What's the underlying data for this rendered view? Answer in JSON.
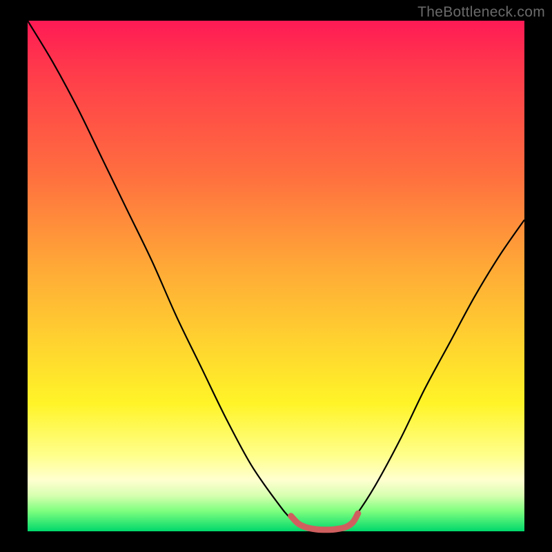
{
  "watermark": "TheBottleneck.com",
  "chart_data": {
    "type": "line",
    "title": "",
    "xlabel": "",
    "ylabel": "",
    "xlim": [
      0,
      1
    ],
    "ylim": [
      0,
      1
    ],
    "background_gradient": {
      "orientation": "vertical",
      "stops": [
        {
          "pos": 0.0,
          "color": "#ff1a55"
        },
        {
          "pos": 0.1,
          "color": "#ff3b4b"
        },
        {
          "pos": 0.3,
          "color": "#ff6e3f"
        },
        {
          "pos": 0.48,
          "color": "#ffa837"
        },
        {
          "pos": 0.62,
          "color": "#ffd030"
        },
        {
          "pos": 0.75,
          "color": "#fff428"
        },
        {
          "pos": 0.85,
          "color": "#ffff8a"
        },
        {
          "pos": 0.9,
          "color": "#ffffd0"
        },
        {
          "pos": 0.93,
          "color": "#d7ffb0"
        },
        {
          "pos": 0.96,
          "color": "#7fff7f"
        },
        {
          "pos": 1.0,
          "color": "#00d86b"
        }
      ]
    },
    "series": [
      {
        "name": "bottleneck-curve",
        "color": "#000000",
        "stroke_width": 2,
        "x": [
          0.0,
          0.05,
          0.1,
          0.15,
          0.2,
          0.25,
          0.3,
          0.35,
          0.4,
          0.45,
          0.5,
          0.53,
          0.56,
          0.6,
          0.64,
          0.66,
          0.7,
          0.75,
          0.8,
          0.85,
          0.9,
          0.95,
          1.0
        ],
        "y": [
          1.0,
          0.92,
          0.83,
          0.73,
          0.63,
          0.53,
          0.42,
          0.32,
          0.22,
          0.13,
          0.06,
          0.025,
          0.01,
          0.005,
          0.01,
          0.03,
          0.09,
          0.18,
          0.28,
          0.37,
          0.46,
          0.54,
          0.61
        ]
      },
      {
        "name": "flat-minimum-marker",
        "color": "#d06060",
        "stroke_width": 9,
        "linecap": "round",
        "x": [
          0.53,
          0.545,
          0.56,
          0.58,
          0.6,
          0.62,
          0.64,
          0.655,
          0.665
        ],
        "y": [
          0.03,
          0.015,
          0.008,
          0.004,
          0.003,
          0.004,
          0.008,
          0.018,
          0.035
        ]
      }
    ]
  }
}
